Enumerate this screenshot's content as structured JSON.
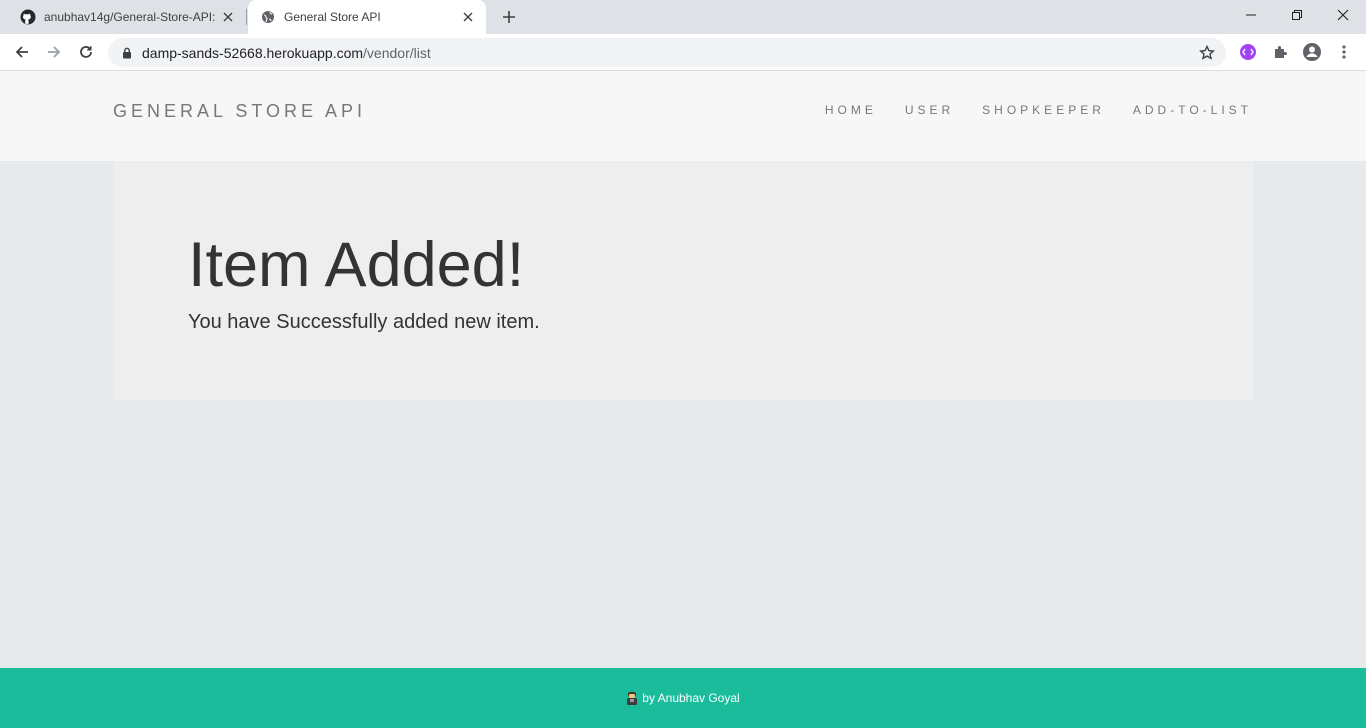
{
  "browser": {
    "tabs": [
      {
        "title": "anubhav14g/General-Store-API: T",
        "active": false,
        "favicon": "github-icon"
      },
      {
        "title": "General Store API",
        "active": true,
        "favicon": "globe-icon"
      }
    ],
    "url_host": "damp-sands-52668.herokuapp.com",
    "url_path": "/vendor/list",
    "profile_color": "#a142f4"
  },
  "navbar": {
    "brand": "GENERAL STORE API",
    "links": [
      "HOME",
      "USER",
      "SHOPKEEPER",
      "ADD-TO-LIST"
    ]
  },
  "main": {
    "heading": "Item Added!",
    "message": "You have Successfully added new item."
  },
  "footer": {
    "credit": "by Anubhav Goyal",
    "color": "#1abc9c"
  }
}
